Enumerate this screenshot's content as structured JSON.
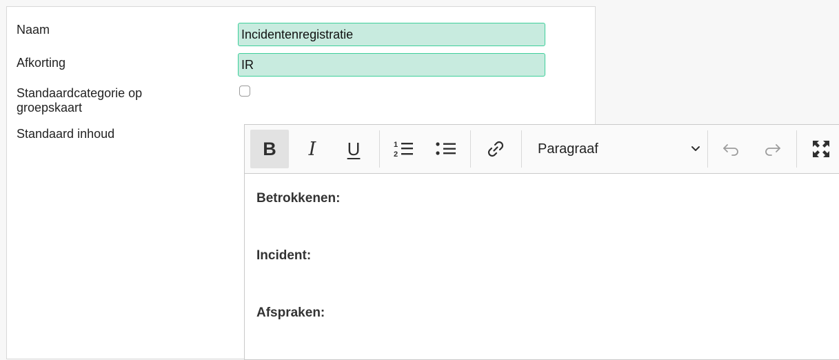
{
  "form": {
    "name_label": "Naam",
    "name_value": "Incidentenregistratie",
    "abbreviation_label": "Afkorting",
    "abbreviation_value": "IR",
    "default_category_label_line1": "Standaardcategorie op",
    "default_category_label_line2": "groepskaart",
    "default_category_checked": false,
    "default_content_label": "Standaard inhoud"
  },
  "editor": {
    "toolbar": {
      "bold_label": "B",
      "italic_label": "I",
      "underline_label": "U",
      "ordered_list_icon": "numbered-list-icon",
      "bulleted_list_icon": "bulleted-list-icon",
      "link_icon": "link-icon",
      "format_selected": "Paragraaf",
      "undo_icon": "undo-icon",
      "redo_icon": "redo-icon",
      "fullscreen_icon": "fullscreen-icon"
    },
    "content": {
      "paragraphs": [
        "Betrokkenen:",
        "Incident:",
        "Afspraken:"
      ]
    }
  },
  "colors": {
    "input_background": "#c8ebdf",
    "input_border": "#3dcf9a",
    "toolbar_active": "#e2e2e2"
  }
}
